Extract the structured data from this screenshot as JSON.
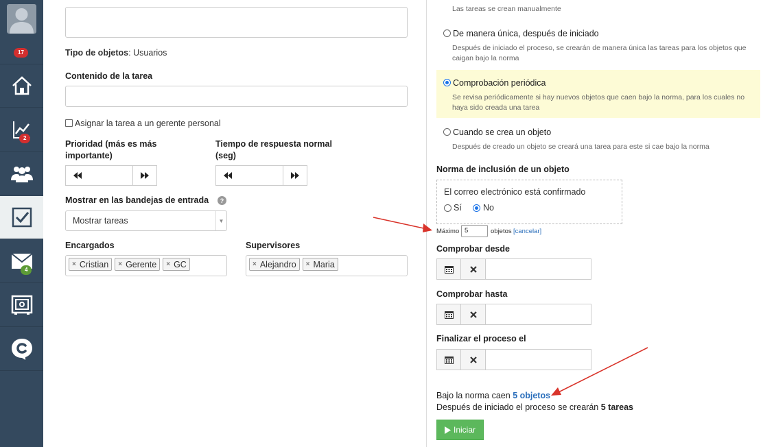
{
  "sidebar": {
    "avatar_badge": "17",
    "items": [
      {
        "icon": "home-icon",
        "badge": null
      },
      {
        "icon": "chart-icon",
        "badge": "2"
      },
      {
        "icon": "users-icon",
        "badge": null
      },
      {
        "icon": "tasks-icon",
        "badge": null,
        "active": true
      },
      {
        "icon": "mail-icon",
        "badge": "4"
      },
      {
        "icon": "safe-icon",
        "badge": null
      },
      {
        "icon": "chat-logo-icon",
        "badge": null
      }
    ]
  },
  "form": {
    "object_type_label": "Tipo de objetos",
    "object_type_value": ": Usuarios",
    "content_label": "Contenido de la tarea",
    "assign_checkbox_label": "Asignar la tarea a un gerente personal",
    "priority_label": "Prioridad (más es más importante)",
    "response_time_label": "Tiempo de respuesta normal (seg)",
    "show_inbox_label": "Mostrar en las bandejas de entrada",
    "show_inbox_value": "Mostrar tareas",
    "assignees_label": "Encargados",
    "assignees": [
      "Cristian",
      "Gerente",
      "GC"
    ],
    "supervisors_label": "Supervisores",
    "supervisors": [
      "Alejandro",
      "Maria"
    ]
  },
  "panel": {
    "option_manual_desc": "Las tareas se crean manualmente",
    "options": [
      {
        "title": "De manera única, después de iniciado",
        "desc": "Después de iniciado el proceso, se crearán de manera única las tareas para los objetos que caigan bajo la norma",
        "selected": false
      },
      {
        "title": "Comprobación periódica",
        "desc": "Se revisa periódicamente si hay nuevos objetos que caen bajo la norma, para los cuales no haya sido creada una tarea",
        "selected": true
      },
      {
        "title": "Cuando se crea un objeto",
        "desc": "Después de creado un objeto se creará una tarea para este si cae bajo la norma",
        "selected": false
      }
    ],
    "inclusion_label": "Norma de inclusión de un objeto",
    "email_confirmed_label": "El correo electrónico está confirmado",
    "yes_label": "Sí",
    "no_label": "No",
    "no_selected": true,
    "max_label": "Máximo",
    "max_value": "5",
    "objects_label": "objetos",
    "cancel_link": "[cancelar]",
    "check_from_label": "Comprobar desde",
    "check_until_label": "Comprobar hasta",
    "finish_label": "Finalizar el proceso el",
    "summary_prefix": "Bajo la norma caen",
    "summary_objects": "5 objetos",
    "summary2_prefix": "Después de iniciado el proceso se crearán",
    "summary2_tasks": "5 tareas",
    "start_button": "Iniciar"
  },
  "colors": {
    "sidebar_bg": "#34495e",
    "highlight_bg": "#fdfbd6",
    "link": "#2a6ebb",
    "start_button": "#5cb85c",
    "arrow": "#d9342b"
  }
}
